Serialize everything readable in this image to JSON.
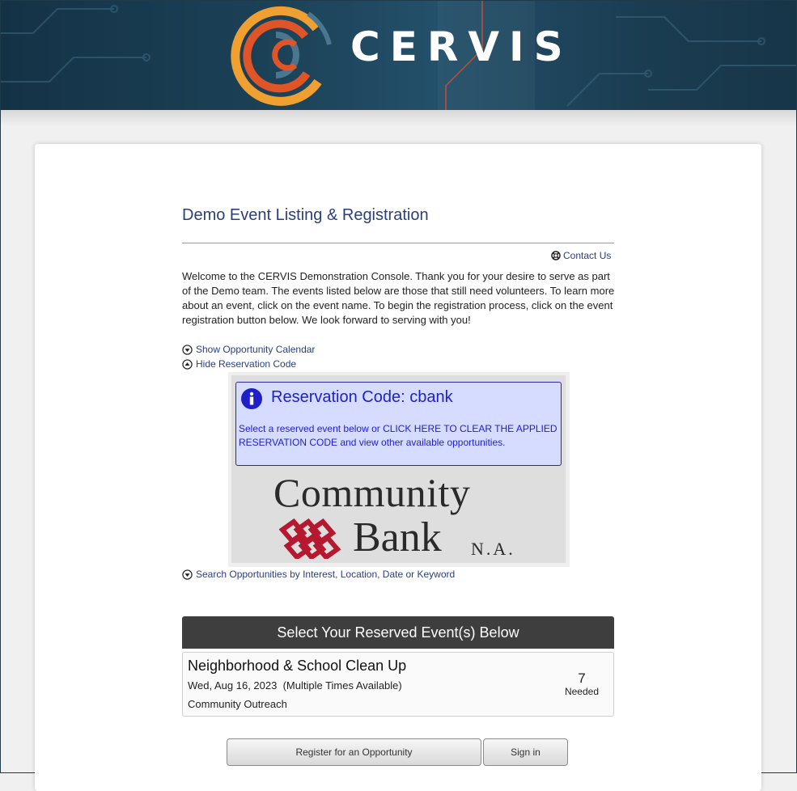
{
  "header": {
    "logo_text": "CERVIS",
    "logo_icon": "cervis-c-logo-icon"
  },
  "page": {
    "title": "Demo Event Listing & Registration",
    "contact_label": "Contact Us",
    "welcome_text": "Welcome to the CERVIS Demonstration Console. Thank you for your desire to serve as part of the Demo team. The events listed below are those that still need volunteers. To learn more about an event, click on the event name. To begin the registration process, click on the event registration button below. We look forward to serving with you!"
  },
  "toggles": {
    "calendar": "Show Opportunity Calendar",
    "reservation": "Hide Reservation Code",
    "search": "Search Opportunities by Interest, Location, Date or Keyword"
  },
  "reservation": {
    "title": "Reservation Code: cbank",
    "text": "Select a reserved event below or CLICK HERE TO CLEAR THE APPLIED RESERVATION CODE and view other available opportunities.",
    "icon": "info-icon"
  },
  "sponsor": {
    "word1": "Community",
    "word2": "Bank",
    "suffix": "N.A."
  },
  "events": {
    "header": "Select Your Reserved Event(s) Below",
    "items": [
      {
        "name": "Neighborhood & School Clean Up",
        "date": "Wed, Aug 16, 2023  (Multiple Times Available)",
        "category": "Community Outreach",
        "needed_count": "7",
        "needed_label": "Needed"
      }
    ]
  },
  "buttons": {
    "register": "Register for an Opportunity",
    "signin": "Sign in"
  },
  "colors": {
    "header_bg": "#1c4258",
    "link": "#2b3f7d",
    "reservation_bg": "#d6dcff",
    "reservation_text": "#1f1fc8",
    "logo_orange": "#f0a030",
    "logo_red": "#e05528"
  }
}
